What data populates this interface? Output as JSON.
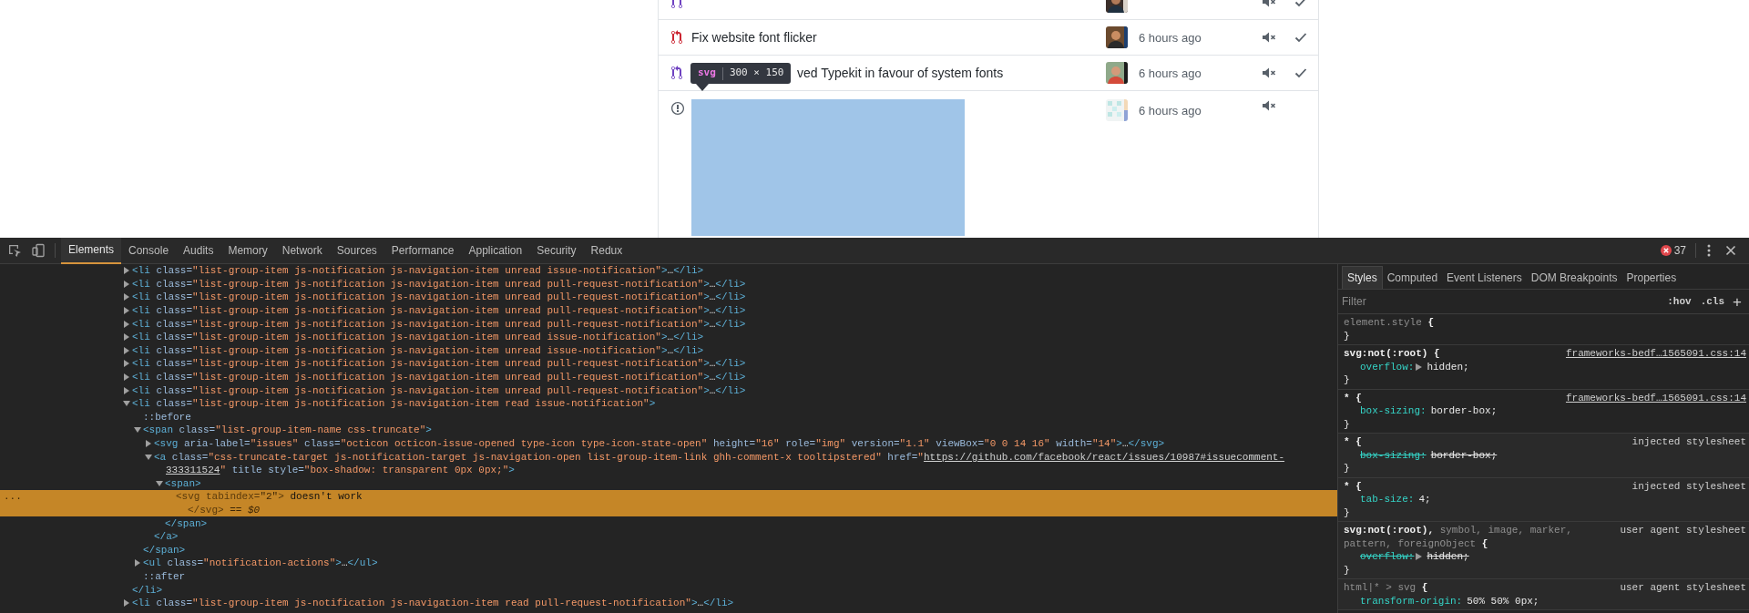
{
  "page": {
    "notifications": [
      {
        "kind": "pull_request",
        "color": "#6f42c1",
        "mark_read_button": true
      },
      {
        "kind": "pull_request",
        "color": "#cb2431",
        "title": "Fix website font flicker",
        "time": "6 hours ago",
        "mark_read_button": true
      },
      {
        "kind": "pull_request",
        "color": "#6f42c1",
        "partly_hidden": true,
        "title": "ved Typekit in favour of system fonts",
        "time": "6 hours ago",
        "mark_read_button": true
      },
      {
        "kind": "issue",
        "color": "#586069",
        "highlighted": true,
        "time": "6 hours ago"
      }
    ],
    "inspect_tooltip": {
      "tag": "svg",
      "size": "300 × 150"
    }
  },
  "devtools": {
    "tabs": [
      {
        "label": "Elements",
        "selected": true
      },
      {
        "label": "Console",
        "selected": false
      },
      {
        "label": "Audits",
        "selected": false
      },
      {
        "label": "Memory",
        "selected": false
      },
      {
        "label": "Network",
        "selected": false
      },
      {
        "label": "Sources",
        "selected": false
      },
      {
        "label": "Performance",
        "selected": false
      },
      {
        "label": "Application",
        "selected": false
      },
      {
        "label": "Security",
        "selected": false
      },
      {
        "label": "Redux",
        "selected": false
      }
    ],
    "error_count": "37",
    "dom": [
      {
        "selected": false,
        "expanded": false,
        "lines": [
          [
            {
              "kind": "tag",
              "text": "<li"
            },
            {
              "kind": "attr",
              "text": " class="
            },
            {
              "kind": "value",
              "text": "\"list-group-item js-notification js-navigation-item unread issue-notification\""
            },
            {
              "kind": "tag",
              "text": ">"
            },
            {
              "kind": "ellipsis",
              "text": "…"
            },
            {
              "kind": "tag",
              "text": "</li>"
            }
          ]
        ]
      },
      {
        "selected": false,
        "expanded": false,
        "lines": [
          [
            {
              "kind": "tag",
              "text": "<li"
            },
            {
              "kind": "attr",
              "text": " class="
            },
            {
              "kind": "value",
              "text": "\"list-group-item js-notification js-navigation-item unread pull-request-notification\""
            },
            {
              "kind": "tag",
              "text": ">"
            },
            {
              "kind": "ellipsis",
              "text": "…"
            },
            {
              "kind": "tag",
              "text": "</li>"
            }
          ]
        ]
      },
      {
        "selected": false,
        "expanded": false,
        "lines": [
          [
            {
              "kind": "tag",
              "text": "<li"
            },
            {
              "kind": "attr",
              "text": " class="
            },
            {
              "kind": "value",
              "text": "\"list-group-item js-notification js-navigation-item unread pull-request-notification\""
            },
            {
              "kind": "tag",
              "text": ">"
            },
            {
              "kind": "ellipsis",
              "text": "…"
            },
            {
              "kind": "tag",
              "text": "</li>"
            }
          ]
        ]
      },
      {
        "selected": false,
        "expanded": false,
        "lines": [
          [
            {
              "kind": "tag",
              "text": "<li"
            },
            {
              "kind": "attr",
              "text": " class="
            },
            {
              "kind": "value",
              "text": "\"list-group-item js-notification js-navigation-item unread pull-request-notification\""
            },
            {
              "kind": "tag",
              "text": ">"
            },
            {
              "kind": "ellipsis",
              "text": "…"
            },
            {
              "kind": "tag",
              "text": "</li>"
            }
          ]
        ]
      },
      {
        "selected": false,
        "expanded": false,
        "lines": [
          [
            {
              "kind": "tag",
              "text": "<li"
            },
            {
              "kind": "attr",
              "text": " class="
            },
            {
              "kind": "value",
              "text": "\"list-group-item js-notification js-navigation-item unread pull-request-notification\""
            },
            {
              "kind": "tag",
              "text": ">"
            },
            {
              "kind": "ellipsis",
              "text": "…"
            },
            {
              "kind": "tag",
              "text": "</li>"
            }
          ]
        ]
      },
      {
        "selected": false,
        "expanded": false,
        "lines": [
          [
            {
              "kind": "tag",
              "text": "<li"
            },
            {
              "kind": "attr",
              "text": " class="
            },
            {
              "kind": "value",
              "text": "\"list-group-item js-notification js-navigation-item unread issue-notification\""
            },
            {
              "kind": "tag",
              "text": ">"
            },
            {
              "kind": "ellipsis",
              "text": "…"
            },
            {
              "kind": "tag",
              "text": "</li>"
            }
          ]
        ]
      },
      {
        "selected": false,
        "expanded": false,
        "lines": [
          [
            {
              "kind": "tag",
              "text": "<li"
            },
            {
              "kind": "attr",
              "text": " class="
            },
            {
              "kind": "value",
              "text": "\"list-group-item js-notification js-navigation-item unread issue-notification\""
            },
            {
              "kind": "tag",
              "text": ">"
            },
            {
              "kind": "ellipsis",
              "text": "…"
            },
            {
              "kind": "tag",
              "text": "</li>"
            }
          ]
        ]
      },
      {
        "selected": false,
        "expanded": false,
        "lines": [
          [
            {
              "kind": "tag",
              "text": "<li"
            },
            {
              "kind": "attr",
              "text": " class="
            },
            {
              "kind": "value",
              "text": "\"list-group-item js-notification js-navigation-item unread pull-request-notification\""
            },
            {
              "kind": "tag",
              "text": ">"
            },
            {
              "kind": "ellipsis",
              "text": "…"
            },
            {
              "kind": "tag",
              "text": "</li>"
            }
          ]
        ]
      },
      {
        "selected": false,
        "expanded": false,
        "lines": [
          [
            {
              "kind": "tag",
              "text": "<li"
            },
            {
              "kind": "attr",
              "text": " class="
            },
            {
              "kind": "value",
              "text": "\"list-group-item js-notification js-navigation-item unread pull-request-notification\""
            },
            {
              "kind": "tag",
              "text": ">"
            },
            {
              "kind": "ellipsis",
              "text": "…"
            },
            {
              "kind": "tag",
              "text": "</li>"
            }
          ]
        ]
      },
      {
        "selected": false,
        "expanded": false,
        "lines": [
          [
            {
              "kind": "tag",
              "text": "<li"
            },
            {
              "kind": "attr",
              "text": " class="
            },
            {
              "kind": "value",
              "text": "\"list-group-item js-notification js-navigation-item unread pull-request-notification\""
            },
            {
              "kind": "tag",
              "text": ">"
            },
            {
              "kind": "ellipsis",
              "text": "…"
            },
            {
              "kind": "tag",
              "text": "</li>"
            }
          ]
        ]
      },
      {
        "selected": false,
        "expanded": true,
        "lines": [
          [
            {
              "kind": "tag",
              "text": "<li"
            },
            {
              "kind": "attr",
              "text": " class="
            },
            {
              "kind": "value",
              "text": "\"list-group-item js-notification js-navigation-item read issue-notification\""
            },
            {
              "kind": "tag",
              "text": ">"
            }
          ]
        ],
        "children": [
          {
            "selected": false,
            "lines": [
              [
                {
                  "kind": "pseudo",
                  "text": "::before"
                }
              ]
            ]
          },
          {
            "selected": false,
            "expanded": true,
            "lines": [
              [
                {
                  "kind": "tag",
                  "text": "<span"
                },
                {
                  "kind": "attr",
                  "text": " class="
                },
                {
                  "kind": "value",
                  "text": "\"list-group-item-name css-truncate\""
                },
                {
                  "kind": "tag",
                  "text": ">"
                }
              ]
            ],
            "children": [
              {
                "selected": false,
                "expanded": false,
                "lines": [
                  [
                    {
                      "kind": "tag",
                      "text": "<svg"
                    },
                    {
                      "kind": "attr",
                      "text": " aria-label="
                    },
                    {
                      "kind": "value",
                      "text": "\"issues\""
                    },
                    {
                      "kind": "attr",
                      "text": " class="
                    },
                    {
                      "kind": "value",
                      "text": "\"octicon octicon-issue-opened type-icon type-icon-state-open\""
                    },
                    {
                      "kind": "attr",
                      "text": " height="
                    },
                    {
                      "kind": "value",
                      "text": "\"16\""
                    },
                    {
                      "kind": "attr",
                      "text": " role="
                    },
                    {
                      "kind": "value",
                      "text": "\"img\""
                    },
                    {
                      "kind": "attr",
                      "text": " version="
                    },
                    {
                      "kind": "value",
                      "text": "\"1.1\""
                    },
                    {
                      "kind": "attr",
                      "text": " viewBox="
                    },
                    {
                      "kind": "value",
                      "text": "\"0 0 14 16\""
                    },
                    {
                      "kind": "attr",
                      "text": " width="
                    },
                    {
                      "kind": "value",
                      "text": "\"14\""
                    },
                    {
                      "kind": "tag",
                      "text": ">"
                    },
                    {
                      "kind": "ellipsis",
                      "text": "…"
                    },
                    {
                      "kind": "tag",
                      "text": "</svg>"
                    }
                  ]
                ]
              },
              {
                "selected": false,
                "expanded": true,
                "lines": [
                  [
                    {
                      "kind": "tag",
                      "text": "<a"
                    },
                    {
                      "kind": "attr",
                      "text": " class="
                    },
                    {
                      "kind": "value",
                      "text": "\"css-truncate-target js-notification-target js-navigation-open list-group-item-link ghh-comment-x tooltipstered\""
                    },
                    {
                      "kind": "attr",
                      "text": " href="
                    },
                    {
                      "kind": "value",
                      "text": "\""
                    },
                    {
                      "kind": "link",
                      "text": "https://github.com/facebook/react/issues/10987#issuecomment-"
                    }
                  ],
                  [
                    {
                      "kind": "link",
                      "text": "333311524"
                    },
                    {
                      "kind": "value",
                      "text": "\""
                    },
                    {
                      "kind": "attr",
                      "text": " title"
                    },
                    {
                      "kind": "attr",
                      "text": " style="
                    },
                    {
                      "kind": "value",
                      "text": "\"box-shadow: transparent 0px 0px;\""
                    },
                    {
                      "kind": "tag",
                      "text": ">"
                    }
                  ]
                ],
                "children": [
                  {
                    "selected": false,
                    "expanded": true,
                    "lines": [
                      [
                        {
                          "kind": "tag",
                          "text": "<span>"
                        }
                      ]
                    ],
                    "children": [
                      {
                        "selected": true,
                        "gutter": "...",
                        "lines": [
                          [
                            {
                              "kind": "tag",
                              "text": "<svg"
                            },
                            {
                              "kind": "attr",
                              "text": " tabindex="
                            },
                            {
                              "kind": "value",
                              "text": "\"2\""
                            },
                            {
                              "kind": "tag",
                              "text": ">"
                            },
                            {
                              "kind": "text",
                              "text": " doesn't work"
                            }
                          ],
                          [
                            {
                              "kind": "tag",
                              "text": "</svg>"
                            },
                            {
                              "kind": "marker",
                              "text": " == $0"
                            }
                          ]
                        ]
                      }
                    ],
                    "closing": [
                      {
                        "kind": "tag",
                        "text": "</span>"
                      }
                    ]
                  }
                ],
                "closing": [
                  {
                    "kind": "tag",
                    "text": "</a>"
                  }
                ]
              }
            ],
            "closing": [
              {
                "kind": "tag",
                "text": "</span>"
              }
            ]
          },
          {
            "selected": false,
            "expanded": false,
            "lines": [
              [
                {
                  "kind": "tag",
                  "text": "<ul"
                },
                {
                  "kind": "attr",
                  "text": " class="
                },
                {
                  "kind": "value",
                  "text": "\"notification-actions\""
                },
                {
                  "kind": "tag",
                  "text": ">"
                },
                {
                  "kind": "ellipsis",
                  "text": "…"
                },
                {
                  "kind": "tag",
                  "text": "</ul>"
                }
              ]
            ]
          },
          {
            "selected": false,
            "lines": [
              [
                {
                  "kind": "pseudo",
                  "text": "::after"
                }
              ]
            ]
          }
        ],
        "closing": [
          {
            "kind": "tag",
            "text": "</li>"
          }
        ]
      },
      {
        "selected": false,
        "expanded": false,
        "lines": [
          [
            {
              "kind": "tag",
              "text": "<li"
            },
            {
              "kind": "attr",
              "text": " class="
            },
            {
              "kind": "value",
              "text": "\"list-group-item js-notification js-navigation-item read pull-request-notification\""
            },
            {
              "kind": "tag",
              "text": ">"
            },
            {
              "kind": "ellipsis",
              "text": "…"
            },
            {
              "kind": "tag",
              "text": "</li>"
            }
          ]
        ]
      }
    ],
    "styles_pane": {
      "tabs": [
        {
          "label": "Styles",
          "selected": true
        },
        {
          "label": "Computed",
          "selected": false
        },
        {
          "label": "Event Listeners",
          "selected": false
        },
        {
          "label": "DOM Breakpoints",
          "selected": false
        },
        {
          "label": "Properties",
          "selected": false
        }
      ],
      "filter": {
        "placeholder": "Filter"
      },
      "hov": ":hov",
      "cls": ".cls",
      "add": "+",
      "rules": [
        {
          "selector": [
            {
              "text": "element.style",
              "matched": false
            },
            {
              "text": " {",
              "matched": true
            }
          ],
          "close": "}"
        },
        {
          "selector": [
            {
              "text": "svg:not(:root)",
              "matched": true
            },
            {
              "text": " {",
              "matched": true
            }
          ],
          "source": "frameworks-bedf…1565091.css:14",
          "kind": "file",
          "close": "}",
          "declarations": [
            {
              "name": "overflow:",
              "value": "hidden;",
              "overridden": false,
              "expandable": true
            }
          ]
        },
        {
          "selector": [
            {
              "text": "*",
              "matched": true
            },
            {
              "text": " {",
              "matched": true
            }
          ],
          "source": "frameworks-bedf…1565091.css:14",
          "kind": "file",
          "close": "}",
          "declarations": [
            {
              "name": "box-sizing:",
              "value": "border-box;",
              "overridden": false,
              "expandable": false
            }
          ]
        },
        {
          "selector": [
            {
              "text": "*",
              "matched": true
            },
            {
              "text": " {",
              "matched": true
            }
          ],
          "source": "injected stylesheet",
          "kind": "injected",
          "close": "}",
          "declarations": [
            {
              "name": "box-sizing:",
              "value": "border-box;",
              "overridden": true,
              "expandable": false
            }
          ]
        },
        {
          "selector": [
            {
              "text": "*",
              "matched": true
            },
            {
              "text": " {",
              "matched": true
            }
          ],
          "source": "injected stylesheet",
          "kind": "injected",
          "close": "}",
          "declarations": [
            {
              "name": "tab-size:",
              "value": "4;",
              "overridden": false,
              "expandable": false
            }
          ]
        },
        {
          "selector": [
            {
              "text": "svg:not(:root),",
              "matched": true
            },
            {
              "text": " symbol, image, marker, ",
              "matched": false
            },
            {
              "text": "pattern, foreignObject",
              "matched": false
            },
            {
              "text": " {",
              "matched": true
            }
          ],
          "source": "user agent stylesheet",
          "kind": "user_agent",
          "close": "}",
          "declarations": [
            {
              "name": "overflow:",
              "value": "hidden;",
              "overridden": true,
              "expandable": true
            }
          ]
        },
        {
          "selector": [
            {
              "text": "html|* > svg",
              "matched": false
            },
            {
              "text": " {",
              "matched": true
            }
          ],
          "source": "user agent stylesheet",
          "kind": "user_agent",
          "declarations": [
            {
              "name": "transform-origin:",
              "value": "50% 50% 0px;",
              "overridden": false,
              "expandable": false
            }
          ]
        }
      ]
    }
  }
}
